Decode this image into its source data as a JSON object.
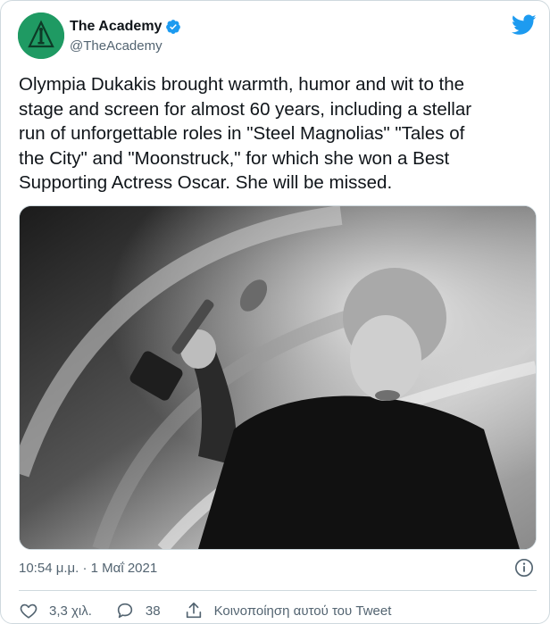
{
  "account": {
    "display_name": "The Academy",
    "handle": "@TheAcademy"
  },
  "tweet": {
    "text": "Olympia Dukakis brought warmth, humor and wit to the\nstage and screen for almost 60 years, including a stellar\nrun of unforgettable roles in \"Steel Magnolias\" \"Tales of\nthe City\" and \"Moonstruck,\" for which she won a Best\nSupporting Actress Oscar. She will be missed.",
    "timestamp": "10:54 μ.μ. · 1 Μαΐ 2021"
  },
  "actions": {
    "likes": "3,3 χιλ.",
    "replies": "38",
    "share_label": "Κοινοποίηση αυτού του Tweet"
  },
  "icons": {
    "avatar": "academy-oscar-logo",
    "verified": "verified-badge-icon",
    "brand": "twitter-bird-icon",
    "info": "info-icon",
    "like": "heart-icon",
    "reply": "comment-icon",
    "share": "share-icon"
  },
  "colors": {
    "avatar_bg": "#1f9a63",
    "twitter_blue": "#1d9bf0",
    "text_primary": "#0f1419",
    "text_secondary": "#536471",
    "border": "#cfd9de"
  }
}
